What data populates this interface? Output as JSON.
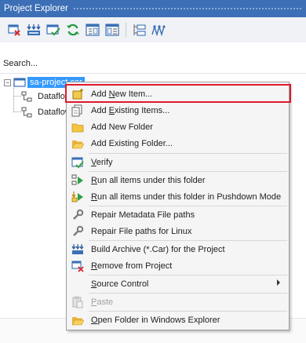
{
  "panel": {
    "title": "Project Explorer"
  },
  "toolbar": {
    "buttons": [
      {
        "id": "remove-item",
        "icon": "remove-icon"
      },
      {
        "id": "build-archive",
        "icon": "build-archive-icon"
      },
      {
        "id": "verify",
        "icon": "verify-icon"
      },
      {
        "id": "refresh",
        "icon": "refresh-icon"
      },
      {
        "id": "collapse-all",
        "icon": "collapse-all-icon"
      },
      {
        "id": "expand-all",
        "icon": "expand-all-icon"
      },
      {
        "id": "properties",
        "icon": "properties-icon"
      },
      {
        "id": "dependencies",
        "icon": "dependencies-icon"
      }
    ]
  },
  "search": {
    "placeholder": "Search...",
    "value": ""
  },
  "tree": {
    "root": {
      "label": "sa-project.car",
      "expanded": true,
      "selected": true
    },
    "children": [
      {
        "label": "Dataflow"
      },
      {
        "label": "Dataflow"
      }
    ]
  },
  "context_menu": {
    "items": [
      {
        "label_before": "Add ",
        "mnemonic": "N",
        "label_after": "ew Item...",
        "icon": "add-new-item-icon",
        "enabled": true
      },
      {
        "label_before": "Add ",
        "mnemonic": "E",
        "label_after": "xisting Items...",
        "icon": "add-existing-items-icon",
        "enabled": true
      },
      {
        "label_before": "Add New Folder",
        "mnemonic": "",
        "label_after": "",
        "icon": "new-folder-icon",
        "enabled": true
      },
      {
        "label_before": "Add Existing Folder...",
        "mnemonic": "",
        "label_after": "",
        "icon": "existing-folder-icon",
        "enabled": true
      },
      {
        "label_before": "",
        "mnemonic": "V",
        "label_after": "erify",
        "icon": "verify-icon",
        "enabled": true
      },
      {
        "label_before": "",
        "mnemonic": "R",
        "label_after": "un all items under this folder",
        "icon": "run-all-icon",
        "enabled": true
      },
      {
        "label_before": "",
        "mnemonic": "R",
        "label_after": "un all items under this folder in Pushdown Mode",
        "icon": "run-pushdown-icon",
        "enabled": true
      },
      {
        "label_before": "Repair Metadata File paths",
        "mnemonic": "",
        "label_after": "",
        "icon": "repair-metadata-icon",
        "enabled": true
      },
      {
        "label_before": "Repair File paths for Linux",
        "mnemonic": "",
        "label_after": "",
        "icon": "repair-linux-icon",
        "enabled": true
      },
      {
        "label_before": "Build Archive (*.Car) for the Project",
        "mnemonic": "",
        "label_after": "",
        "icon": "build-archive-icon",
        "enabled": true
      },
      {
        "label_before": "",
        "mnemonic": "R",
        "label_after": "emove from Project",
        "icon": "remove-icon",
        "enabled": true
      },
      {
        "label_before": "",
        "mnemonic": "S",
        "label_after": "ource Control",
        "icon": "none",
        "enabled": true,
        "submenu": true
      },
      {
        "label_before": "",
        "mnemonic": "P",
        "label_after": "aste",
        "icon": "paste-icon",
        "enabled": false
      },
      {
        "label_before": "",
        "mnemonic": "O",
        "label_after": "pen Folder in Windows Explorer",
        "icon": "open-folder-icon",
        "enabled": true
      }
    ]
  },
  "colors": {
    "title_bar": "#3c6fb6",
    "selection": "#3399ff",
    "highlight_box": "#e0192b",
    "menu_background": "#f5f5f5"
  }
}
